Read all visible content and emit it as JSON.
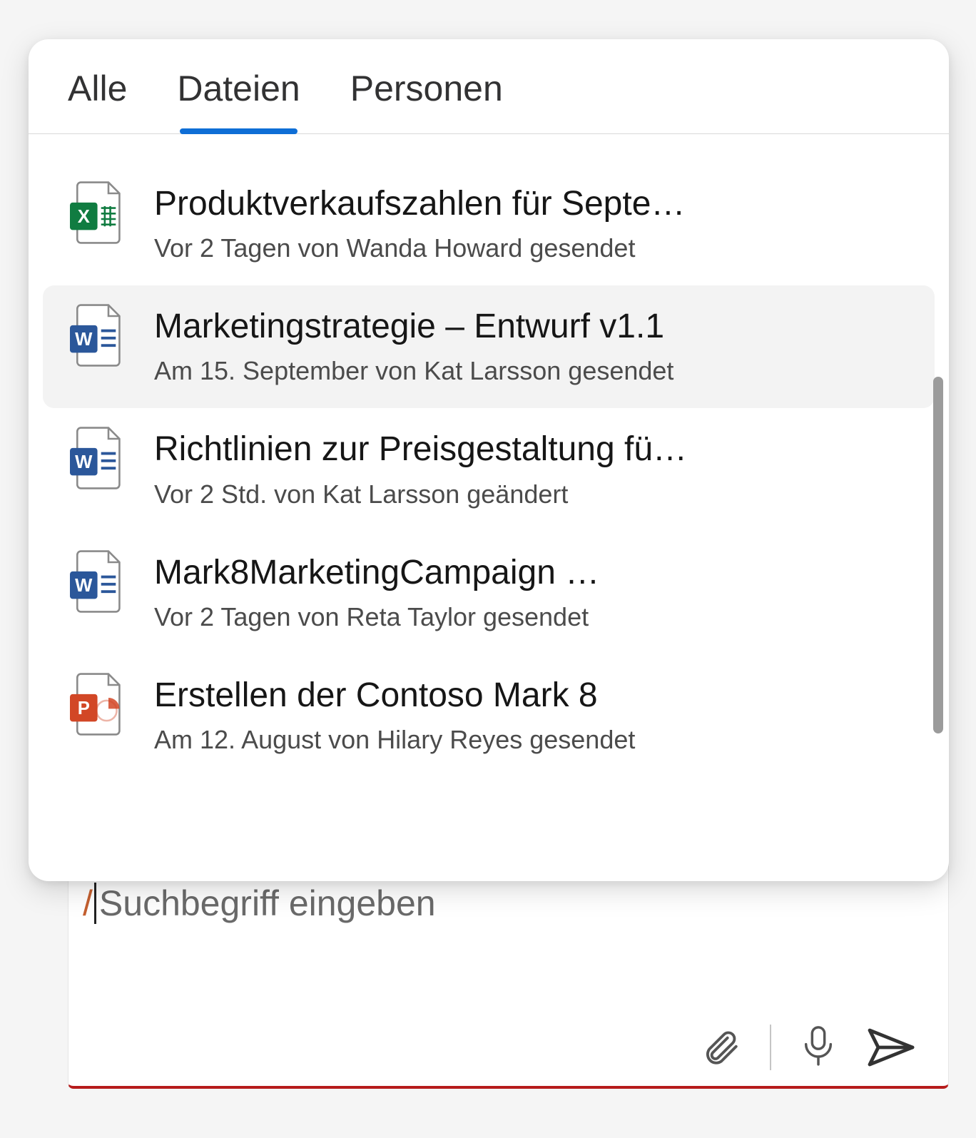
{
  "tabs": {
    "all": {
      "label": "Alle",
      "active": false
    },
    "files": {
      "label": "Dateien",
      "active": true
    },
    "people": {
      "label": "Personen",
      "active": false
    }
  },
  "files": [
    {
      "type": "excel",
      "title": "Produktverkaufszahlen für Septe…",
      "sub": "Vor 2 Tagen von Wanda Howard gesendet",
      "highlight": false
    },
    {
      "type": "word",
      "title": "Marketingstrategie – Entwurf v1.1",
      "sub": "Am 15. September von Kat Larsson gesendet",
      "highlight": true
    },
    {
      "type": "word",
      "title": "Richtlinien zur Preisgestaltung fü…",
      "sub": "Vor 2 Std. von Kat Larsson geändert",
      "highlight": false
    },
    {
      "type": "word",
      "title": "Mark8MarketingCampaign …",
      "sub": "Vor 2 Tagen von Reta Taylor gesendet",
      "highlight": false
    },
    {
      "type": "powerpoint",
      "title": "Erstellen der Contoso Mark 8",
      "sub": "Am 12. August von Hilary Reyes gesendet",
      "highlight": false
    }
  ],
  "input": {
    "prefix": "/",
    "placeholder": "Suchbegriff eingeben"
  },
  "icons": {
    "excel": {
      "letter": "X",
      "brand": "#107c41"
    },
    "word": {
      "letter": "W",
      "brand": "#2b579a"
    },
    "powerpoint": {
      "letter": "P",
      "brand": "#d24726"
    }
  }
}
